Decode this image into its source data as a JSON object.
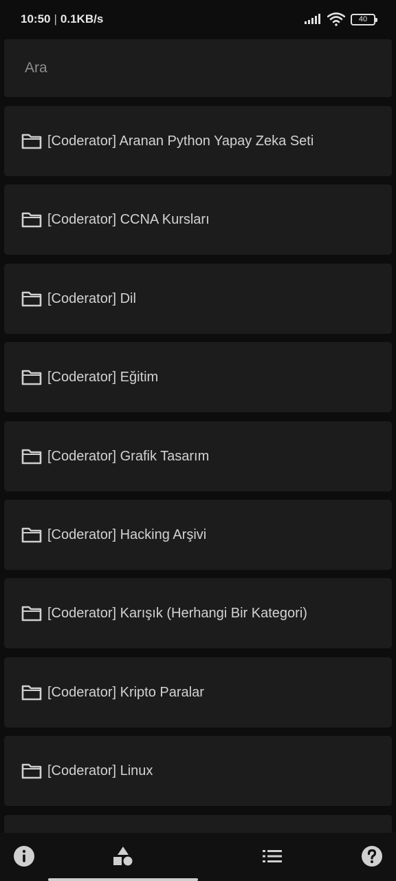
{
  "status_bar": {
    "time": "10:50",
    "separator": "|",
    "network_speed": "0.1KB/s",
    "battery": "40",
    "icons": [
      "signal-icon",
      "wifi-icon",
      "battery-icon"
    ]
  },
  "search": {
    "placeholder": "Ara",
    "value": ""
  },
  "folders": [
    {
      "label": "[Coderator] Aranan Python Yapay Zeka Seti"
    },
    {
      "label": "[Coderator] CCNA Kursları"
    },
    {
      "label": "[Coderator] Dil"
    },
    {
      "label": "[Coderator] Eğitim"
    },
    {
      "label": "[Coderator] Grafik Tasarım"
    },
    {
      "label": "[Coderator] Hacking Arşivi"
    },
    {
      "label": "[Coderator] Karışık (Herhangi Bir Kategori)"
    },
    {
      "label": "[Coderator] Kripto Paralar"
    },
    {
      "label": "[Coderator] Linux"
    },
    {
      "label": ""
    }
  ],
  "bottom_nav": {
    "items": [
      "info-icon",
      "shapes-icon",
      "list-icon",
      "help-icon"
    ]
  },
  "colors": {
    "background": "#0d0d0d",
    "card": "#1c1c1c",
    "text": "#d2d2d2",
    "placeholder": "#8d8d8d",
    "icon": "#d0d0d0"
  }
}
